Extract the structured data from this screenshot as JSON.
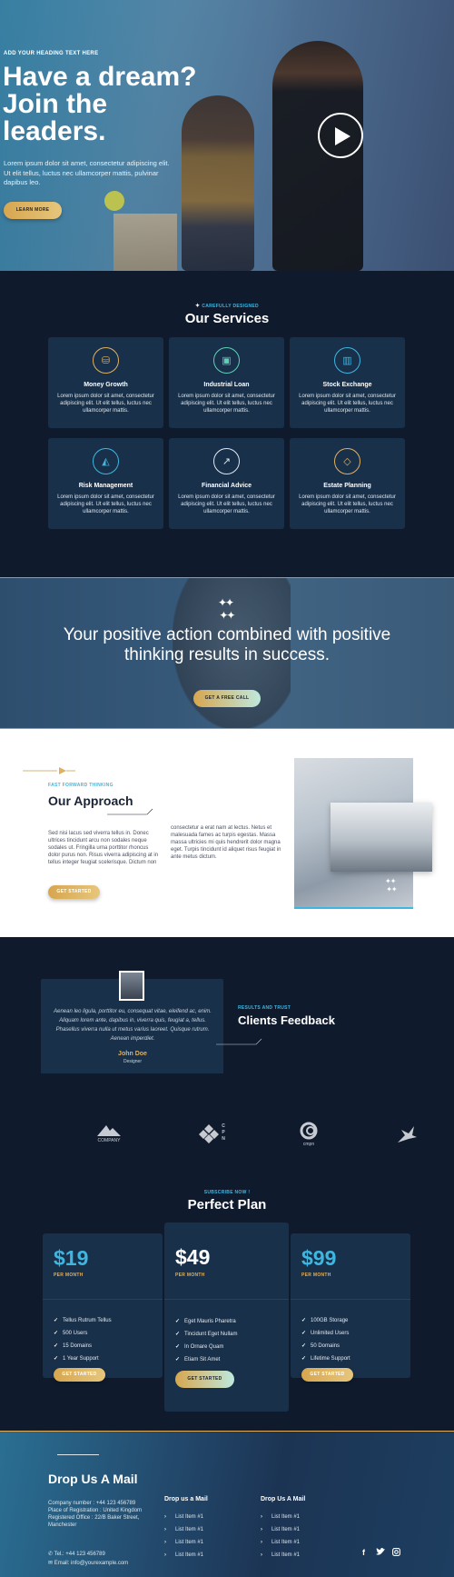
{
  "hero": {
    "kicker": "ADD YOUR HEADING TEXT HERE",
    "title": "Have a dream? Join the leaders.",
    "text": "Lorem ipsum dolor sit amet, consectetur adipiscing elit. Ut elit tellus, luctus nec ullamcorper mattis, pulvinar dapibus leo.",
    "button": "LEARN MORE"
  },
  "services": {
    "kicker": "CAREFULLY DESIGNED",
    "title": "Our Services",
    "items": [
      {
        "title": "Money Growth",
        "desc": "Lorem ipsum dolor sit amet, consectetur adipiscing elit. Ut elit tellus, luctus nec ullamcorper mattis.",
        "icon": "coins-icon",
        "color": "#e0b060"
      },
      {
        "title": "Industrial Loan",
        "desc": "Lorem ipsum dolor sit amet, consectetur adipiscing elit. Ut elit tellus, luctus nec ullamcorper mattis.",
        "icon": "money-bill-icon",
        "color": "#5ed0b6"
      },
      {
        "title": "Stock Exchange",
        "desc": "Lorem ipsum dolor sit amet, consectetur adipiscing elit. Ut elit tellus, luctus nec ullamcorper mattis.",
        "icon": "bar-chart-icon",
        "color": "#3fb6e0"
      },
      {
        "title": "Risk Management",
        "desc": "Lorem ipsum dolor sit amet, consectetur adipiscing elit. Ut elit tellus, luctus nec ullamcorper mattis.",
        "icon": "money-bag-icon",
        "color": "#3fb6e0"
      },
      {
        "title": "Financial Advice",
        "desc": "Lorem ipsum dolor sit amet, consectetur adipiscing elit. Ut elit tellus, luctus nec ullamcorper mattis.",
        "icon": "line-chart-icon",
        "color": "#dfe8ef"
      },
      {
        "title": "Estate Planning",
        "desc": "Lorem ipsum dolor sit amet, consectetur adipiscing elit. Ut elit tellus, luctus nec ullamcorper mattis.",
        "icon": "diamond-icon",
        "color": "#e0b060"
      }
    ]
  },
  "cta": {
    "text": "Your positive action combined with positive thinking results in success.",
    "button": "GET A FREE CALL"
  },
  "approach": {
    "kicker": "FAST FORWARD THINKING",
    "title": "Our Approach",
    "p1": "Sed nisi lacus sed viverra tellus in. Donec ultrices tincidunt arcu non sodales neque sodales ut. Fringilla urna porttitor rhoncus dolor purus non. Risus viverra adipiscing at in tellus integer feugiat scelerisque. Dictum non",
    "p2": "consectetur a erat nam at lectus. Netus et malesuada fames ac turpis egestas. Massa massa ultricies mi quis hendrerit dolor magna eget. Turpis tincidunt id aliquet risus feugiat in ante metus dictum.",
    "button": "GET STARTED"
  },
  "testimonial": {
    "quote": "Aenean leo ligula, porttitor eu, consequat vitae, eleifend ac, enim. Aliquam lorem ante, dapibus in, viverra quis, feugiat a, tellus. Phasellus viverra nulla ut metus varius laoreet. Quisque rutrum. Aenean imperdiet.",
    "name": "John Doe",
    "role": "Designer",
    "kicker": "RESULTS AND TRUST",
    "title": "Clients Feedback"
  },
  "logos": [
    {
      "label": "COMPANY",
      "icon": "mountain-logo-icon"
    },
    {
      "label": "C P N",
      "icon": "diamond-grid-logo-icon"
    },
    {
      "label": "cmpn",
      "icon": "ring-logo-icon"
    },
    {
      "label": "",
      "icon": "bird-logo-icon"
    }
  ],
  "pricing": {
    "kicker": "SUBSCRIBE NOW !",
    "title": "Perfect Plan",
    "plans": [
      {
        "price": "$19",
        "per": "PER MONTH",
        "features": [
          "Tellus Rutrum Tellus",
          "500 Users",
          "15 Domains",
          "1 Year Support"
        ],
        "button": "GET STARTED",
        "price_color": "#3fb6e0"
      },
      {
        "price": "$49",
        "per": "PER MONTH",
        "features": [
          "Eget Mauris Pharetra",
          "Tincidunt Eget Nullam",
          "In Ornare Quam",
          "Etiam Sit Amet"
        ],
        "button": "GET STARTED",
        "price_color": "#ffffff"
      },
      {
        "price": "$99",
        "per": "PER MONTH",
        "features": [
          "100GB Storage",
          "Unlimited Users",
          "50 Domains",
          "Lifetime Support"
        ],
        "button": "GET STARTED",
        "price_color": "#3fb6e0"
      }
    ]
  },
  "footer": {
    "title": "Drop Us A Mail",
    "info": "Company number : +44 123 456789 Place of Registration : United Kingdom Registered Office : 22/B Baker Street, Manchester",
    "tel": "Tel.: +44 123 456789",
    "email": "Email: info@yourexample.com",
    "col1": {
      "heading": "Drop us a Mail",
      "items": [
        "List Item #1",
        "List Item #1",
        "List Item #1",
        "List Item #1"
      ]
    },
    "col2": {
      "heading": "Drop Us A Mail",
      "items": [
        "List Item #1",
        "List Item #1",
        "List Item #1",
        "List Item #1"
      ]
    },
    "social": [
      "facebook-icon",
      "twitter-icon",
      "instagram-icon"
    ]
  }
}
